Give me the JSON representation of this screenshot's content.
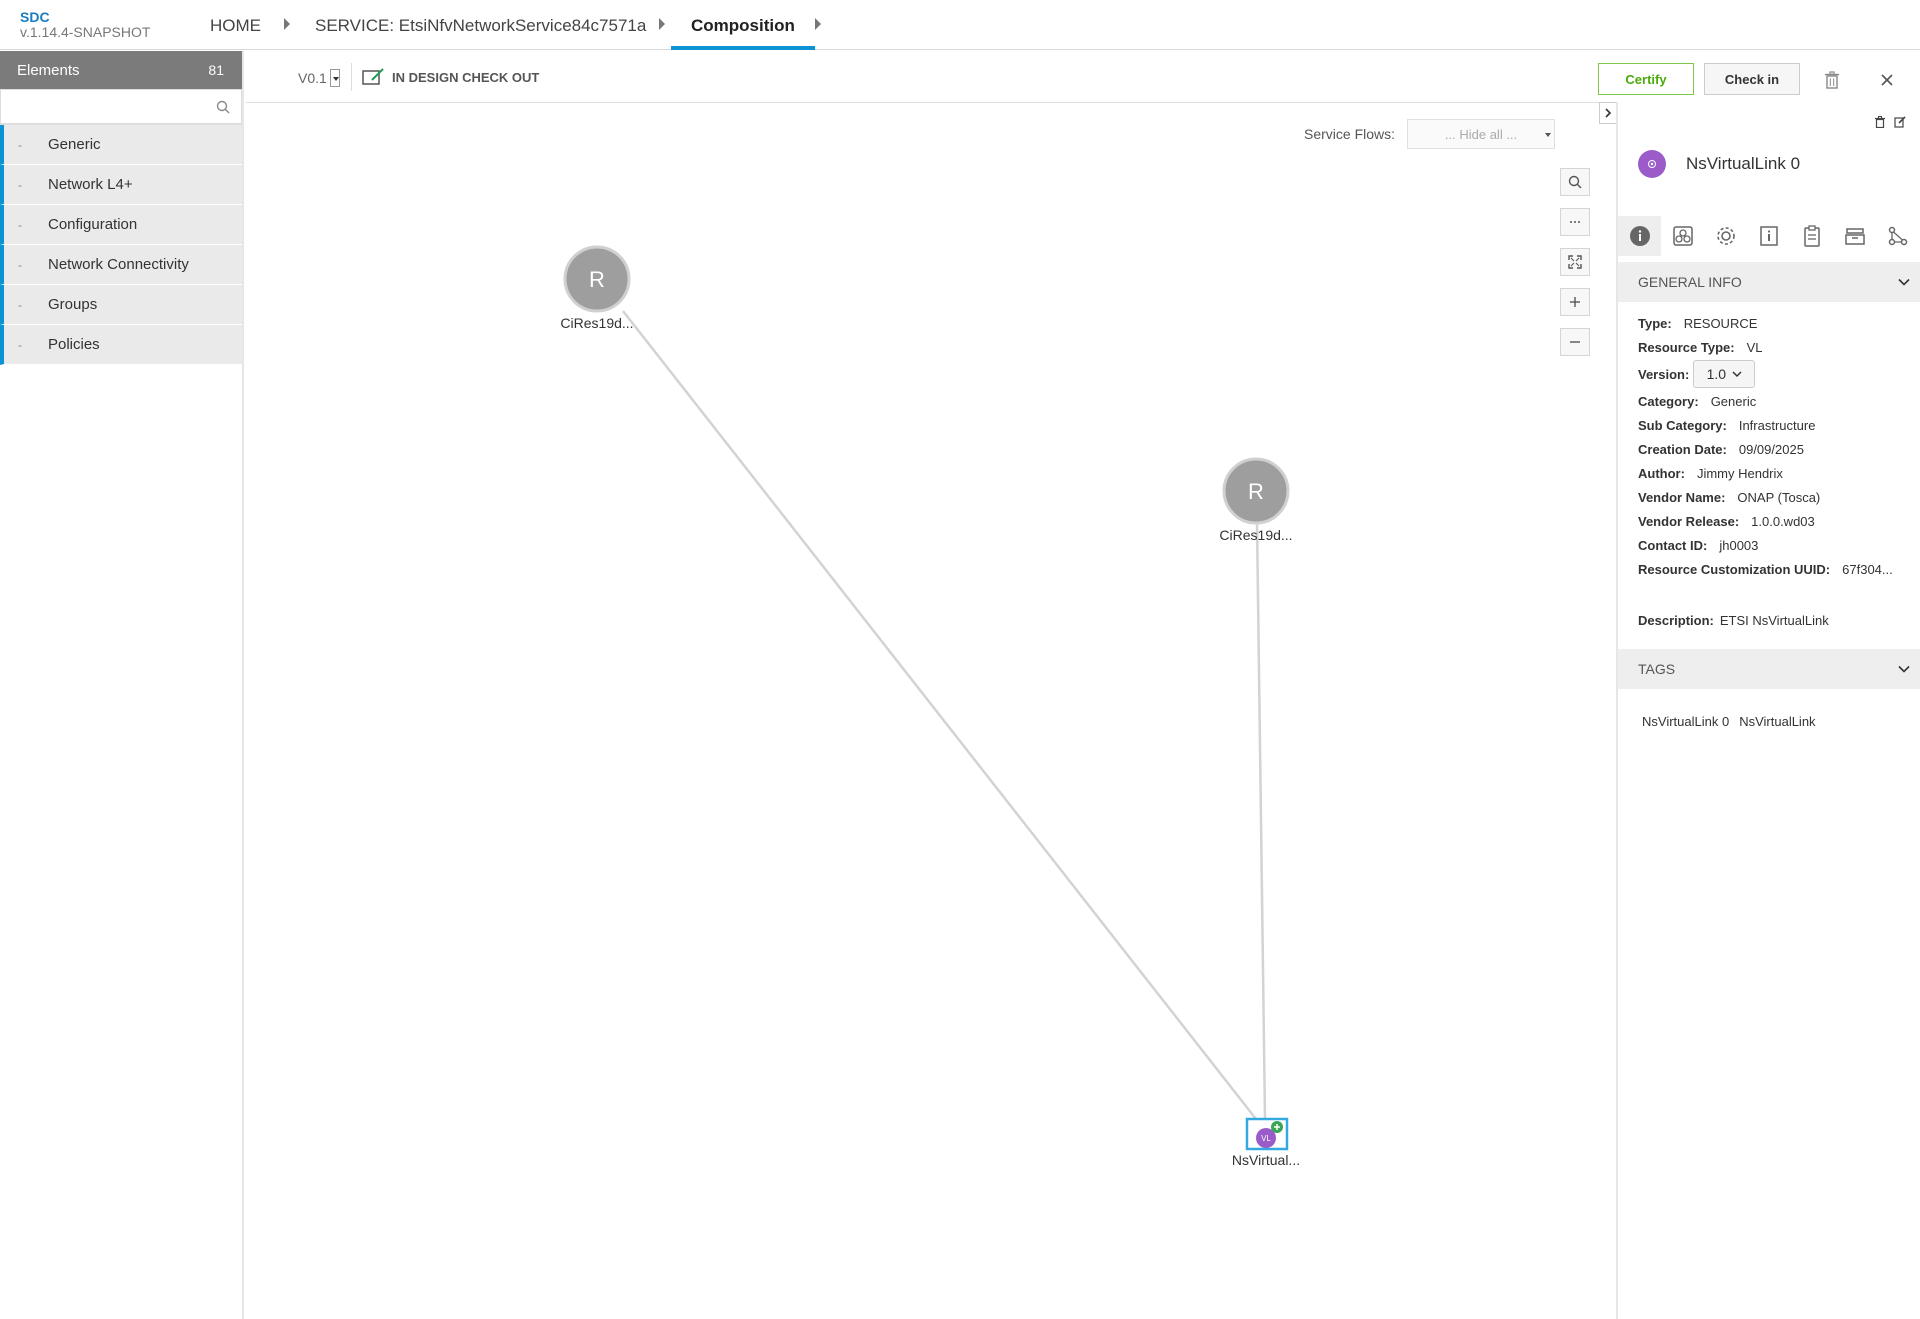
{
  "header": {
    "app_name": "SDC",
    "app_version": "v.1.14.4-SNAPSHOT",
    "breadcrumbs": [
      "HOME",
      "SERVICE: EtsiNfvNetworkService84c7571a",
      "Composition"
    ]
  },
  "palette": {
    "title": "Elements",
    "count": "81",
    "search_placeholder": "",
    "categories": [
      "Generic",
      "Network L4+",
      "Configuration",
      "Network Connectivity",
      "Groups",
      "Policies"
    ]
  },
  "toolbar": {
    "version": "V0.1",
    "status": "IN DESIGN CHECK OUT",
    "certify_label": "Certify",
    "checkin_label": "Check in"
  },
  "canvas": {
    "service_flows_label": "Service Flows:",
    "service_flows_value": "... Hide all ...",
    "nodes": [
      {
        "icon_letter": "R",
        "label": "CiRes19d..."
      },
      {
        "icon_letter": "R",
        "label": "CiRes19d..."
      },
      {
        "icon_letter": "VL",
        "label": "NsVirtual..."
      }
    ]
  },
  "details": {
    "title": "NsVirtualLink 0",
    "general_info_label": "GENERAL INFO",
    "fields": {
      "type": {
        "label": "Type:",
        "value": "RESOURCE"
      },
      "resource_type": {
        "label": "Resource Type:",
        "value": "VL"
      },
      "version": {
        "label": "Version:",
        "value": "1.0"
      },
      "category": {
        "label": "Category:",
        "value": "Generic"
      },
      "sub_category": {
        "label": "Sub Category:",
        "value": "Infrastructure"
      },
      "creation_date": {
        "label": "Creation Date:",
        "value": "09/09/2025"
      },
      "author": {
        "label": "Author:",
        "value": "Jimmy Hendrix"
      },
      "vendor_name": {
        "label": "Vendor Name:",
        "value": "ONAP (Tosca)"
      },
      "vendor_release": {
        "label": "Vendor Release:",
        "value": "1.0.0.wd03"
      },
      "contact_id": {
        "label": "Contact ID:",
        "value": "jh0003"
      },
      "customization_uuid": {
        "label": "Resource Customization UUID:",
        "value": "67f304..."
      },
      "description": {
        "label": "Description:",
        "value": "ETSI NsVirtualLink"
      }
    },
    "tags_label": "TAGS",
    "tags": [
      "NsVirtualLink 0",
      "NsVirtualLink"
    ]
  },
  "colors": {
    "accent": "#0c93d3",
    "certify": "#4ca90c",
    "node_gray": "#9e9e9e",
    "vl_purple": "#9b5cc9",
    "add_green": "#3aa655"
  }
}
